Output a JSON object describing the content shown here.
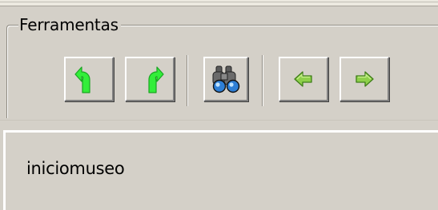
{
  "toolbar_group": {
    "title": "Ferramentas",
    "buttons": [
      {
        "name": "undo",
        "icon": "undo-arrow-icon"
      },
      {
        "name": "redo",
        "icon": "redo-arrow-icon"
      },
      {
        "name": "find",
        "icon": "binoculars-icon"
      },
      {
        "name": "back",
        "icon": "arrow-left-icon"
      },
      {
        "name": "forward",
        "icon": "arrow-right-icon"
      }
    ]
  },
  "status_panel": {
    "text": "iniciomuseo"
  },
  "colors": {
    "window_bg": "#d4d0c8",
    "icon_green": "#33ee3a",
    "arrow_green": "#6fbf2a"
  }
}
